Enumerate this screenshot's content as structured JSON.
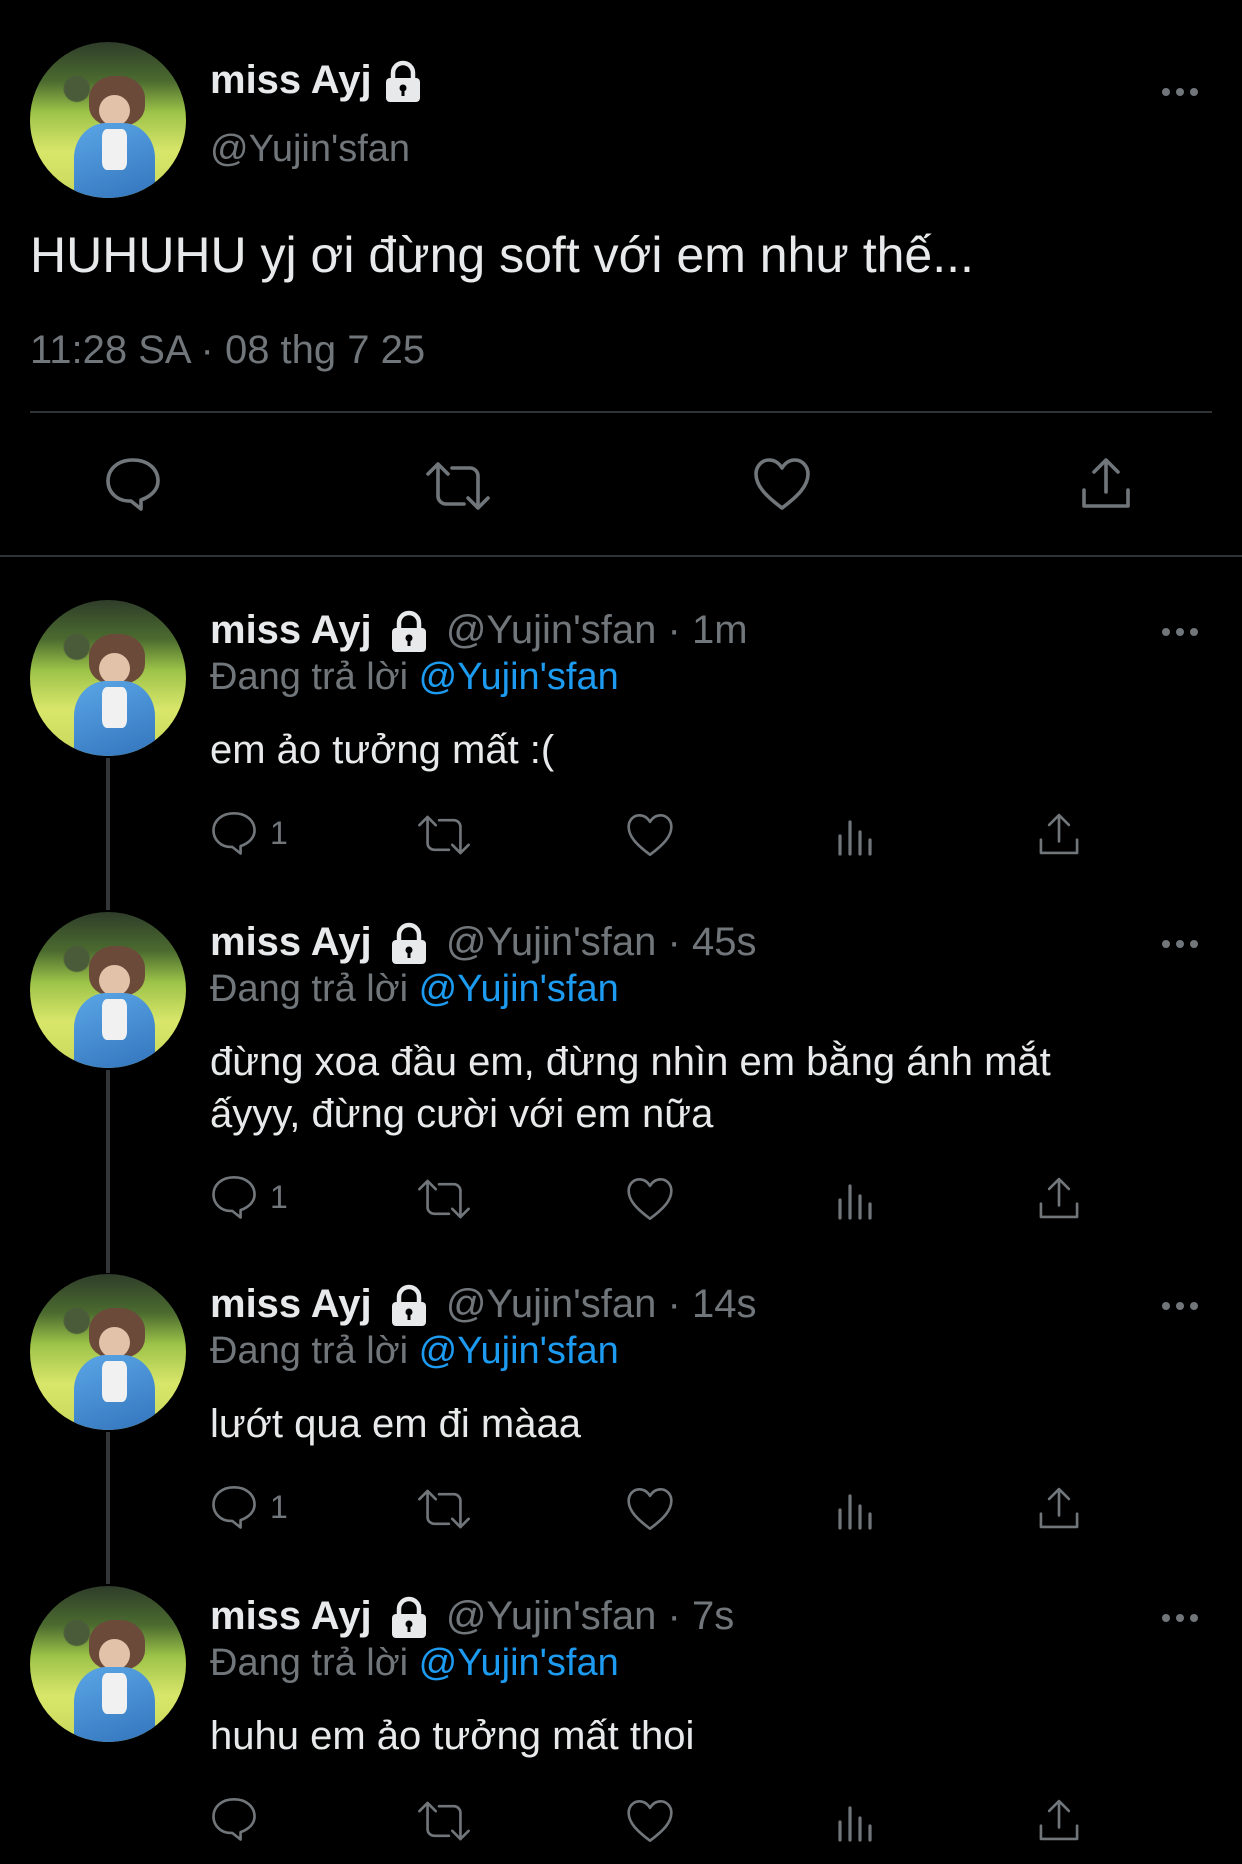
{
  "main_tweet": {
    "display_name": "miss Ayj",
    "handle": "@Yujin'sfan",
    "text": "HUHUHU yj ơi đừng soft với em như thế...",
    "timestamp": "11:28 SA · 08 thg 7 25"
  },
  "replies": [
    {
      "display_name": "miss Ayj",
      "handle": "@Yujin'sfan",
      "time": "· 1m",
      "replying_label": "Đang trả lời",
      "replying_to": "@Yujin'sfan",
      "text_lines": [
        "em ảo tưởng mất :("
      ],
      "reply_count": "1"
    },
    {
      "display_name": "miss Ayj",
      "handle": "@Yujin'sfan",
      "time": "· 45s",
      "replying_label": "Đang trả lời",
      "replying_to": "@Yujin'sfan",
      "text_lines": [
        "đừng xoa đầu em, đừng nhìn em bằng ánh mắt",
        "ấyyy, đừng cười với em nữa"
      ],
      "reply_count": "1"
    },
    {
      "display_name": "miss Ayj",
      "handle": "@Yujin'sfan",
      "time": "· 14s",
      "replying_label": "Đang trả lời",
      "replying_to": "@Yujin'sfan",
      "text_lines": [
        "lướt qua em đi màaa"
      ],
      "reply_count": "1"
    },
    {
      "display_name": "miss Ayj",
      "handle": "@Yujin'sfan",
      "time": "· 7s",
      "replying_label": "Đang trả lời",
      "replying_to": "@Yujin'sfan",
      "text_lines": [
        "huhu em ảo tưởng mất thoi"
      ],
      "reply_count": ""
    }
  ],
  "colors": {
    "background": "#000000",
    "text": "#e7e9ea",
    "muted": "#71767b",
    "link": "#1d9bf0",
    "divider": "#2f3336"
  }
}
